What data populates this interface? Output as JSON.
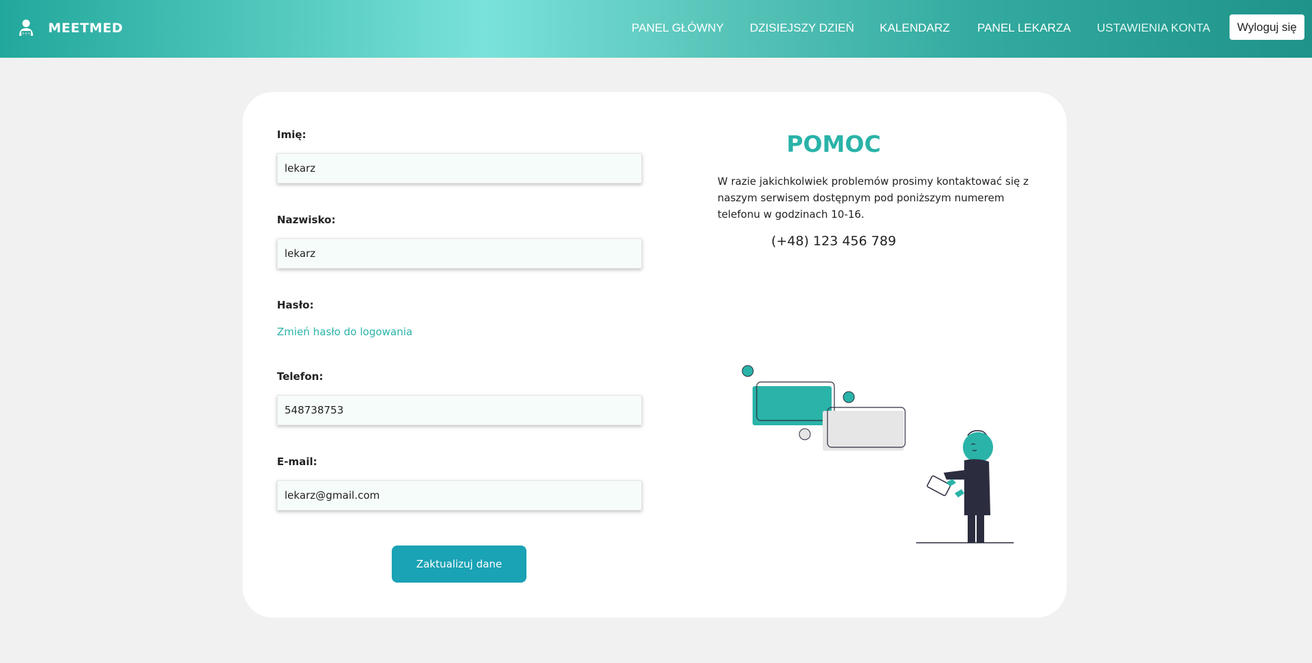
{
  "brand": {
    "name": "MEETMED"
  },
  "nav": {
    "items": [
      {
        "label": "PANEL GŁÓWNY"
      },
      {
        "label": "DZISIEJSZY DZIEŃ"
      },
      {
        "label": "KALENDARZ"
      },
      {
        "label": "PANEL LEKARZA"
      },
      {
        "label": "USTAWIENIA KONTA"
      }
    ],
    "logout_label": "Wyloguj się"
  },
  "form": {
    "first_name": {
      "label": "Imię:",
      "value": "lekarz"
    },
    "last_name": {
      "label": "Nazwisko:",
      "value": "lekarz"
    },
    "password": {
      "label": "Hasło:",
      "link": "Zmień hasło do logowania"
    },
    "phone": {
      "label": "Telefon:",
      "value": "548738753"
    },
    "email": {
      "label": "E-mail:",
      "value": "lekarz@gmail.com"
    },
    "submit_label": "Zaktualizuj dane"
  },
  "help": {
    "title": "POMOC",
    "text": "W razie jakichkolwiek problemów prosimy kontaktować się z naszym serwisem dostępnym pod poniższym numerem telefonu w godzinach 10-16.",
    "phone": "(+48) 123 456 789"
  },
  "colors": {
    "accent": "#2ab3a8",
    "button": "#1aa2b5",
    "nav_gradient_start": "#22a79c",
    "nav_gradient_mid": "#7ae2d9",
    "nav_gradient_end": "#1f9389"
  },
  "icons": {
    "brand": "doctor-user-icon"
  }
}
